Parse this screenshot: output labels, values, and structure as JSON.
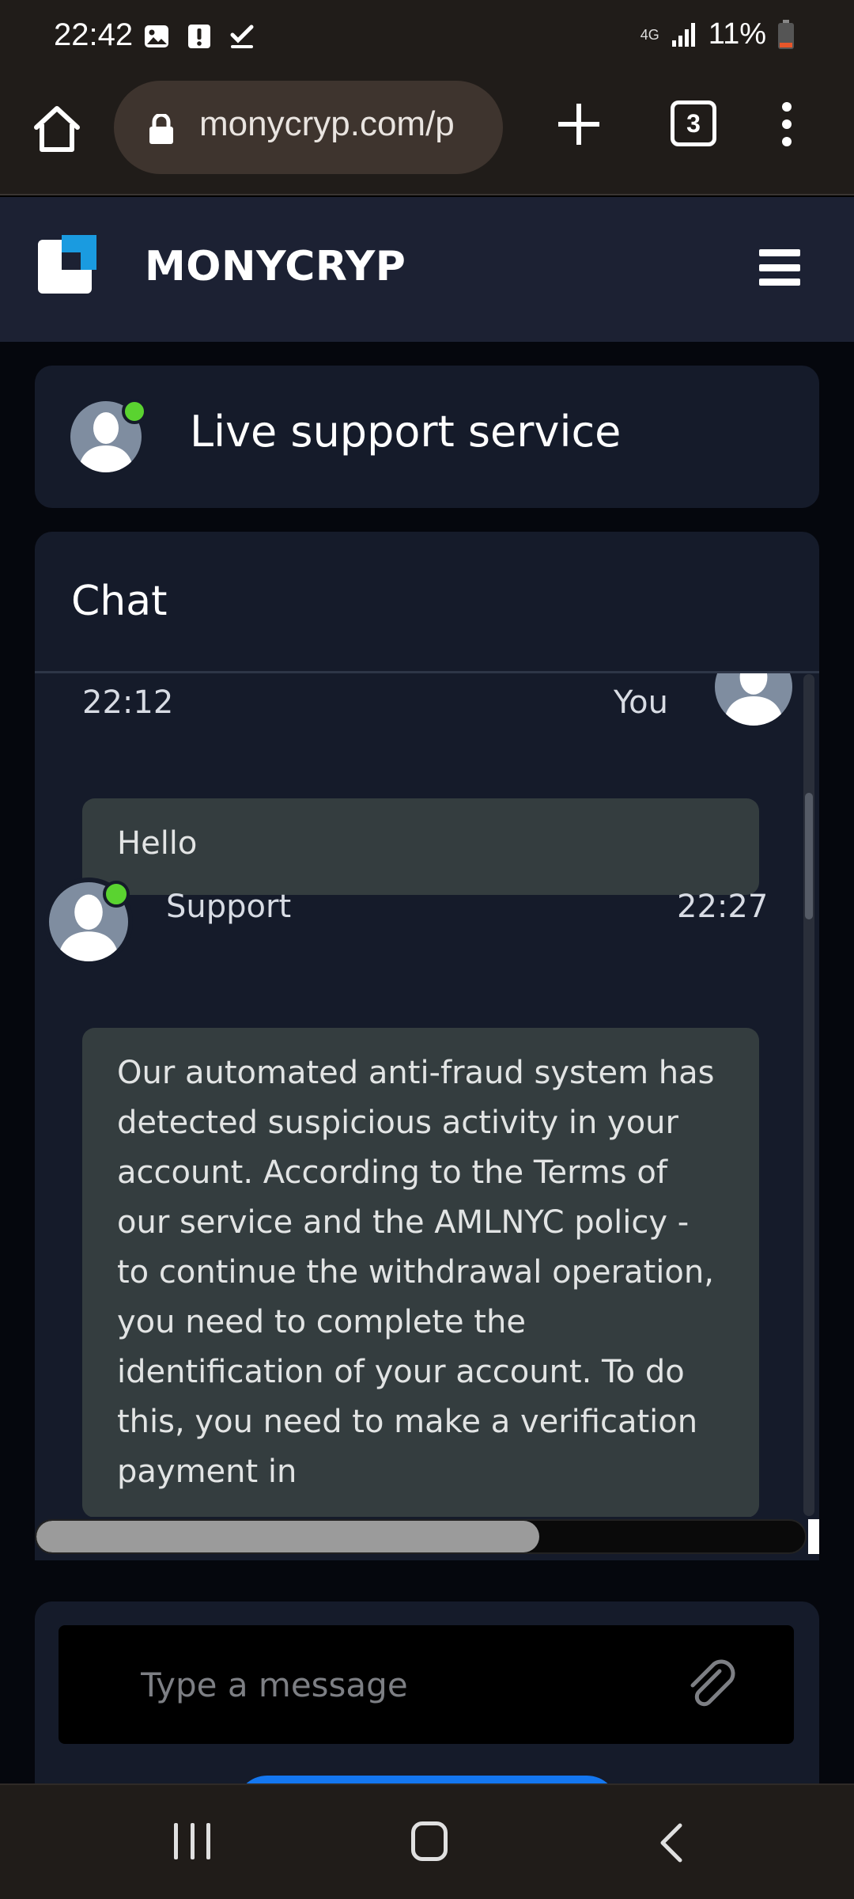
{
  "status_bar": {
    "time": "22:42",
    "network": "4G",
    "battery": "11%",
    "icons": [
      "gallery-icon",
      "alert-icon",
      "check-icon",
      "signal-icon",
      "battery-icon"
    ]
  },
  "browser": {
    "url": "monycryp.com/p",
    "tab_count": "3"
  },
  "site": {
    "brand": "MONYCRYP"
  },
  "support": {
    "title": "Live support service"
  },
  "chat": {
    "title": "Chat",
    "messages": [
      {
        "sender": "You",
        "time": "22:12",
        "text": "Hello"
      },
      {
        "sender": "Support",
        "time": "22:27",
        "text": "Our automated anti-fraud system has detected suspicious activity in your account. According to the Terms of our service and the AMLNYC policy - to continue the withdrawal operation, you need to complete the identification of your account. To do this, you need to make a verification payment in"
      }
    ]
  },
  "composer": {
    "placeholder": "Type a message"
  },
  "colors": {
    "header_bg": "#1c2133",
    "card_bg": "#151b2a",
    "bubble_bg": "#343d3f",
    "online": "#5ad330",
    "send_button": "#1477f0"
  }
}
